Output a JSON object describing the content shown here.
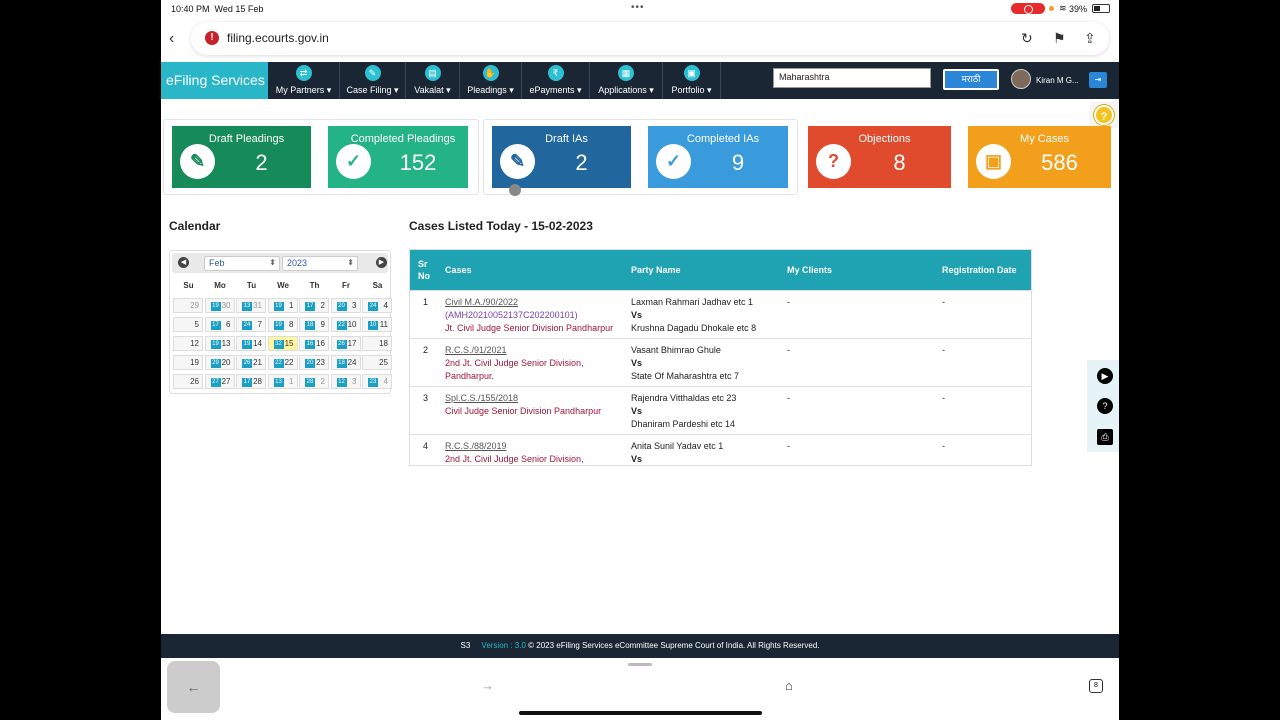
{
  "status": {
    "time": "10:40 PM",
    "date": "Wed 15 Feb",
    "battery": "39%"
  },
  "browser": {
    "url": "filing.ecourts.gov.in"
  },
  "nav": {
    "brand": "eFiling Services",
    "menus": [
      {
        "label": "My Partners",
        "icon": "partners-icon"
      },
      {
        "label": "Case Filing",
        "icon": "pen-icon"
      },
      {
        "label": "Vakalat",
        "icon": "document-icon"
      },
      {
        "label": "Pleadings",
        "icon": "hands-icon"
      },
      {
        "label": "ePayments",
        "icon": "rupee-icon"
      },
      {
        "label": "Applications",
        "icon": "form-icon"
      },
      {
        "label": "Portfolio",
        "icon": "briefcase-icon"
      }
    ],
    "state_value": "Maharashtra",
    "lang_button": "मराठी",
    "user_name": "Kiran M G..."
  },
  "cards": [
    {
      "title": "Draft Pleadings",
      "value": "2",
      "icon": "edit-icon",
      "color": "#178a5a"
    },
    {
      "title": "Completed Pleadings",
      "value": "152",
      "icon": "check-icon",
      "color": "#23b385"
    },
    {
      "title": "Draft IAs",
      "value": "2",
      "icon": "edit-icon",
      "color": "#21679e"
    },
    {
      "title": "Completed IAs",
      "value": "9",
      "icon": "check-icon",
      "color": "#3a9bdc"
    },
    {
      "title": "Objections",
      "value": "8",
      "icon": "question-icon",
      "color": "#e04a2d"
    },
    {
      "title": "My Cases",
      "value": "586",
      "icon": "briefcase-icon",
      "color": "#f2a01b"
    }
  ],
  "calendar": {
    "title": "Calendar",
    "month": "Feb",
    "year": "2023",
    "dows": [
      "Su",
      "Mo",
      "Tu",
      "We",
      "Th",
      "Fr",
      "Sa"
    ],
    "weeks": [
      [
        {
          "d": "29",
          "o": true
        },
        {
          "d": "30",
          "o": true,
          "b": "19"
        },
        {
          "d": "31",
          "o": true,
          "b": "13"
        },
        {
          "d": "1",
          "b": "19"
        },
        {
          "d": "2",
          "b": "17"
        },
        {
          "d": "3",
          "b": "20"
        },
        {
          "d": "4",
          "b": "24"
        }
      ],
      [
        {
          "d": "5"
        },
        {
          "d": "6",
          "b": "17"
        },
        {
          "d": "7",
          "b": "24"
        },
        {
          "d": "8",
          "b": "19"
        },
        {
          "d": "9",
          "b": "18"
        },
        {
          "d": "10",
          "b": "22"
        },
        {
          "d": "11",
          "b": "10"
        }
      ],
      [
        {
          "d": "12"
        },
        {
          "d": "13",
          "b": "19"
        },
        {
          "d": "14",
          "b": "19"
        },
        {
          "d": "15",
          "b": "32",
          "t": true
        },
        {
          "d": "16",
          "b": "16"
        },
        {
          "d": "17",
          "b": "26"
        },
        {
          "d": "18"
        }
      ],
      [
        {
          "d": "19"
        },
        {
          "d": "20",
          "b": "29"
        },
        {
          "d": "21",
          "b": "26"
        },
        {
          "d": "22",
          "b": "22"
        },
        {
          "d": "23",
          "b": "20"
        },
        {
          "d": "24",
          "b": "18"
        },
        {
          "d": "25"
        }
      ],
      [
        {
          "d": "26"
        },
        {
          "d": "27",
          "b": "27"
        },
        {
          "d": "28",
          "b": "17"
        },
        {
          "d": "1",
          "o": true,
          "b": "13"
        },
        {
          "d": "2",
          "o": true,
          "b": "28"
        },
        {
          "d": "3",
          "o": true,
          "b": "12"
        },
        {
          "d": "4",
          "o": true,
          "b": "23"
        }
      ]
    ]
  },
  "cases": {
    "title": "Cases Listed Today - 15-02-2023",
    "headers": {
      "srno": "Sr No",
      "cases": "Cases",
      "party": "Party Name",
      "clients": "My Clients",
      "regdate": "Registration Date"
    },
    "vs": "Vs",
    "rows": [
      {
        "sr": "1",
        "case_no": "Civil M.A./90/2022",
        "cnr": "(AMH20210052137C202200101)",
        "court": "Jt. Civil Judge Senior Division Pandharpur",
        "court2": "",
        "p1": "Laxman Rahmari Jadhav etc 1",
        "p2": "Krushna Dagadu Dhokale etc 8",
        "clients": "-",
        "reg": "-"
      },
      {
        "sr": "2",
        "case_no": "R.C.S./91/2021",
        "cnr": "",
        "court": "2nd Jt. Civil Judge Senior Division,",
        "court2": "Pandharpur.",
        "p1": "Vasant Bhimrao Ghule",
        "p2": "State Of Maharashtra etc 7",
        "clients": "-",
        "reg": "-"
      },
      {
        "sr": "3",
        "case_no": "Spl.C.S./155/2018",
        "cnr": "",
        "court": "Civil Judge Senior Division Pandharpur",
        "court2": "",
        "p1": "Rajendra Vitthaldas etc 23",
        "p2": "Dhaniram Pardeshi etc 14",
        "clients": "-",
        "reg": "-"
      },
      {
        "sr": "4",
        "case_no": "R.C.S./88/2019",
        "cnr": "",
        "court": "2nd Jt. Civil Judge Senior Division,",
        "court2": "",
        "p1": "Anita Sunil Yadav etc 1",
        "p2": "",
        "clients": "-",
        "reg": "-"
      }
    ]
  },
  "footer": {
    "code": "S3",
    "version": "Version : 3.0",
    "copyright": "© 2023 eFiling Services eCommittee Supreme Court of India. All Rights Reserved."
  },
  "toolbar": {
    "tabs_count": "8"
  }
}
